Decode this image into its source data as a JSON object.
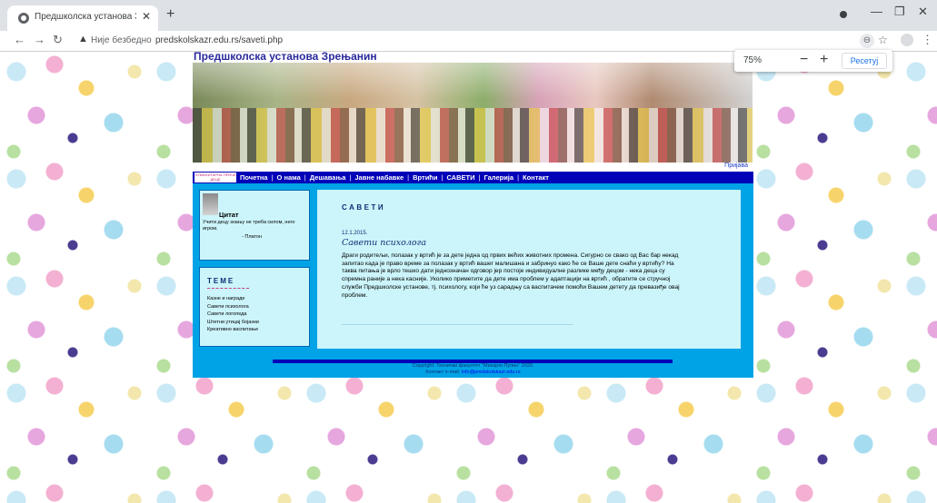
{
  "browser": {
    "tab_title": "Предшколска установа Зрењан",
    "tab_close": "✕",
    "new_tab": "+",
    "security_label": "Није безбедно",
    "url": "predskolskazr.edu.rs/saveti.php",
    "zoom": {
      "level": "75%",
      "minus": "−",
      "plus": "+",
      "reset_label": "Ресетуј"
    }
  },
  "site": {
    "title": "Предшколска установа Зрењанин",
    "login_link": "Пријава",
    "logo_text": "ХУМАНИТАРНА ПРИЧЕ ДЕЦЕ",
    "nav": {
      "items": [
        "Почетна",
        "О нама",
        "Дешавања",
        "Јавне набавке",
        "Вртићи",
        "САВЕТИ",
        "Галерија",
        "Контакт"
      ],
      "separator": "|"
    },
    "quote": {
      "heading": "Цитат",
      "text": "Учити децу знању не треба силом, него игром.",
      "author": "- Платон"
    },
    "topics": {
      "heading": "ТЕМЕ",
      "items": [
        "Казне и награде",
        "Савети психолога",
        "Савети логопеда",
        "Штетни утицај бојанки",
        "Креативно васпитање"
      ]
    },
    "article": {
      "heading": "САВЕТИ",
      "date": "12.1.2015.",
      "title": "Савети психолога",
      "body": "Драги родитељи, полазак у вртић је за дете једна од првих већих животних промена. Сигурно се свако од Вас бар некад запитао када је право време за полазак у вртић вашег малишана и забринуо како ће се Ваше дете снаћи у вртићу? На таква питања је врло тешко дати једнозначан одговор јер постоје индивидуалне разлике међу децом - нека деца су спремна раније а нека касније. Уколико приметите да дете има проблем у адаптацији на вртић , обратите се стручној служби Предшколске установе, тј. психологу, који ће уз сарадњу са васпитачем помоћи Вашем детету да превазиђе овај проблем."
    },
    "footer": {
      "copyright": "Copyright: Технички факултет \"Михајло Пупин\" 2020.",
      "contact_label": "Контакт e-mail:",
      "contact_email": "info@predskolskazr.edu.rs"
    }
  },
  "colors": {
    "nav_bg": "#0000b8",
    "content_bg": "#00a3e6",
    "panel_bg": "#ccf5fb",
    "title": "#2a2a9e"
  }
}
